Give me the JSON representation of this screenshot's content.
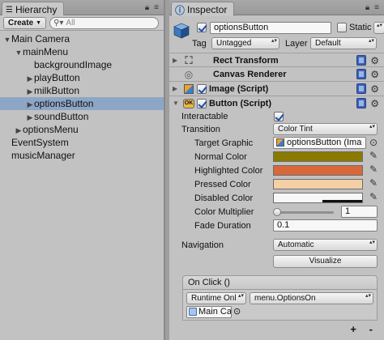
{
  "hierarchy": {
    "tab_label": "Hierarchy",
    "create_label": "Create",
    "search_placeholder": "All",
    "items": [
      {
        "label": "Main Camera",
        "depth": 0,
        "arrow": "▼"
      },
      {
        "label": "mainMenu",
        "depth": 1,
        "arrow": "▼"
      },
      {
        "label": "backgroundImage",
        "depth": 2,
        "arrow": ""
      },
      {
        "label": "playButton",
        "depth": 2,
        "arrow": "▶"
      },
      {
        "label": "milkButton",
        "depth": 2,
        "arrow": "▶"
      },
      {
        "label": "optionsButton",
        "depth": 2,
        "arrow": "▶",
        "selected": true
      },
      {
        "label": "soundButton",
        "depth": 2,
        "arrow": "▶"
      },
      {
        "label": "optionsMenu",
        "depth": 1,
        "arrow": "▶"
      },
      {
        "label": "EventSystem",
        "depth": 0,
        "arrow": ""
      },
      {
        "label": "musicManager",
        "depth": 0,
        "arrow": ""
      }
    ]
  },
  "inspector": {
    "tab_label": "Inspector",
    "object_name": "optionsButton",
    "static_label": "Static",
    "tag_label": "Tag",
    "tag_value": "Untagged",
    "layer_label": "Layer",
    "layer_value": "Default",
    "components": {
      "rect_transform": "Rect Transform",
      "canvas_renderer": "Canvas Renderer",
      "image_script": "Image (Script)",
      "button_script": "Button (Script)"
    },
    "button": {
      "interactable_label": "Interactable",
      "transition_label": "Transition",
      "transition_value": "Color Tint",
      "target_graphic_label": "Target Graphic",
      "target_graphic_value": "optionsButton (Ima",
      "normal_color_label": "Normal Color",
      "highlighted_color_label": "Highlighted Color",
      "pressed_color_label": "Pressed Color",
      "disabled_color_label": "Disabled Color",
      "color_multiplier_label": "Color Multiplier",
      "color_multiplier_value": "1",
      "fade_duration_label": "Fade Duration",
      "fade_duration_value": "0.1",
      "navigation_label": "Navigation",
      "navigation_value": "Automatic",
      "visualize_label": "Visualize",
      "onclick_label": "On Click ()",
      "runtime_value": "Runtime Onl",
      "function_value": "menu.OptionsOn",
      "object_value": "Main Ca",
      "plus_label": "+",
      "minus_label": "-"
    },
    "colors": {
      "normal": "#8a7a00",
      "highlighted": "#d8683a",
      "pressed": "#f5cfa5",
      "disabled": "#f7f7f7"
    }
  }
}
